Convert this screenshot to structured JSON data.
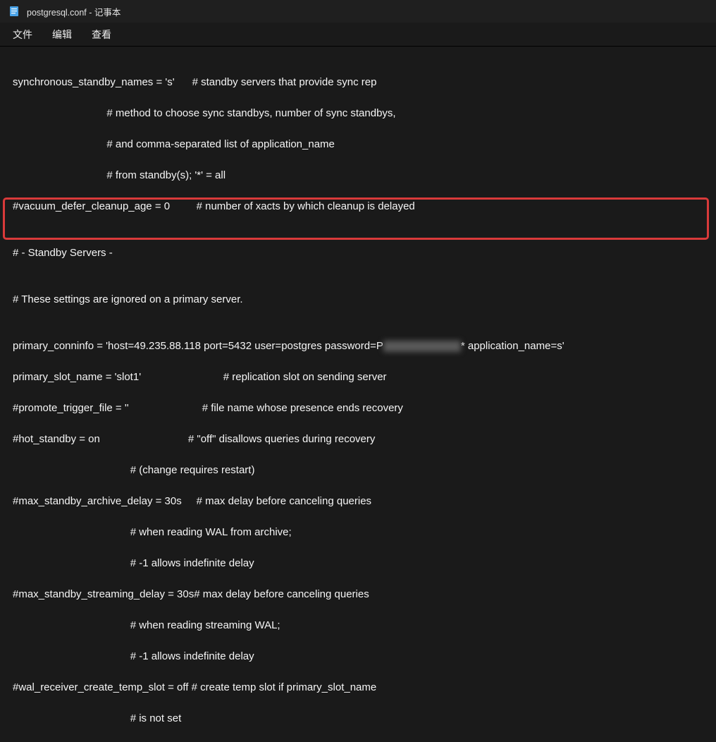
{
  "titlebar": {
    "title": "postgresql.conf - 记事本"
  },
  "menu": {
    "file": "文件",
    "edit": "编辑",
    "view": "查看"
  },
  "lines": {
    "l1": "synchronous_standby_names = 's'      # standby servers that provide sync rep",
    "l2": "                                # method to choose sync standbys, number of sync standbys,",
    "l3": "                                # and comma-separated list of application_name",
    "l4": "                                # from standby(s); '*' = all",
    "l5": "#vacuum_defer_cleanup_age = 0         # number of xacts by which cleanup is delayed",
    "l6": "",
    "l7": "# - Standby Servers -",
    "l8": "",
    "l9": "# These settings are ignored on a primary server.",
    "l10": "",
    "l11a": "primary_conninfo = 'host=49.235.88.118 port=5432 user=postgres password=P",
    "l11b": "* application_name=s'",
    "l12": "primary_slot_name = 'slot1'                            # replication slot on sending server",
    "l13": "#promote_trigger_file = ''                         # file name whose presence ends recovery",
    "l14": "#hot_standby = on                              # \"off\" disallows queries during recovery",
    "l15": "                                        # (change requires restart)",
    "l16": "#max_standby_archive_delay = 30s     # max delay before canceling queries",
    "l17": "                                        # when reading WAL from archive;",
    "l18": "                                        # -1 allows indefinite delay",
    "l19": "#max_standby_streaming_delay = 30s# max delay before canceling queries",
    "l20": "                                        # when reading streaming WAL;",
    "l21": "                                        # -1 allows indefinite delay",
    "l22": "#wal_receiver_create_temp_slot = off # create temp slot if primary_slot_name",
    "l23": "                                        # is not set"
  }
}
